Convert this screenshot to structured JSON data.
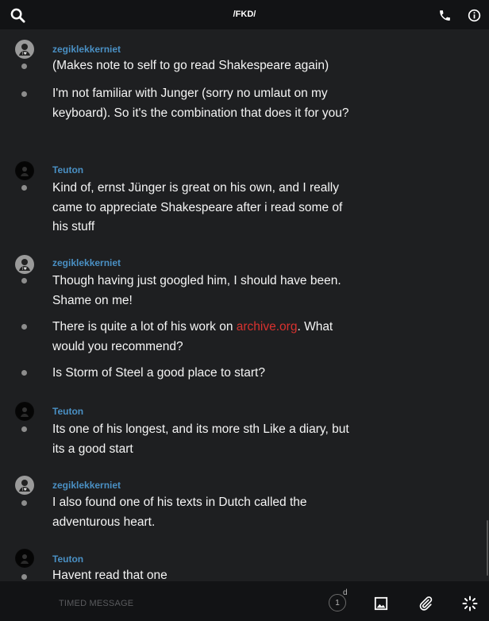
{
  "header": {
    "title": "/FKD/"
  },
  "messages": [
    {
      "user": "zegiklekkerniet",
      "avatar": "zeg",
      "lines": [
        "(Makes note to self to go read Shakespeare again)",
        "I'm not familiar with Junger (sorry no umlaut on my keyboard). So it's the combination that does it for you?"
      ]
    },
    {
      "user": "Teuton",
      "avatar": "teu",
      "lines": [
        "Kind of,  ernst Jünger is great on his own, and I really came to appreciate Shakespeare after i read some of his stuff"
      ]
    },
    {
      "user": "zegiklekkerniet",
      "avatar": "zeg",
      "lines": [
        "Though having just googled him, I should have been. Shame on me!",
        "There is quite a lot of his work on archive.org. What would you recommend?",
        "Is Storm of Steel a good place to start?"
      ]
    },
    {
      "user": "Teuton",
      "avatar": "teu",
      "lines": [
        "Its one of his longest, and its more sth Like a diary, but its a good start"
      ]
    },
    {
      "user": "zegiklekkerniet",
      "avatar": "zeg",
      "lines": [
        "I also found one of his texts in Dutch called the adventurous heart."
      ]
    },
    {
      "user": "Teuton",
      "avatar": "teu",
      "lines": [
        "Havent read that one"
      ]
    }
  ],
  "link_text": "archive.org",
  "composer": {
    "placeholder": "TIMED MESSAGE",
    "timer_value": "1",
    "timer_unit": "d"
  },
  "colors": {
    "username": "#4a90c4",
    "link": "#d9322f",
    "background": "#1e1f21",
    "bar": "#121315"
  },
  "icons": [
    "search-icon",
    "phone-icon",
    "info-icon",
    "image-icon",
    "paperclip-icon",
    "loading-icon"
  ]
}
